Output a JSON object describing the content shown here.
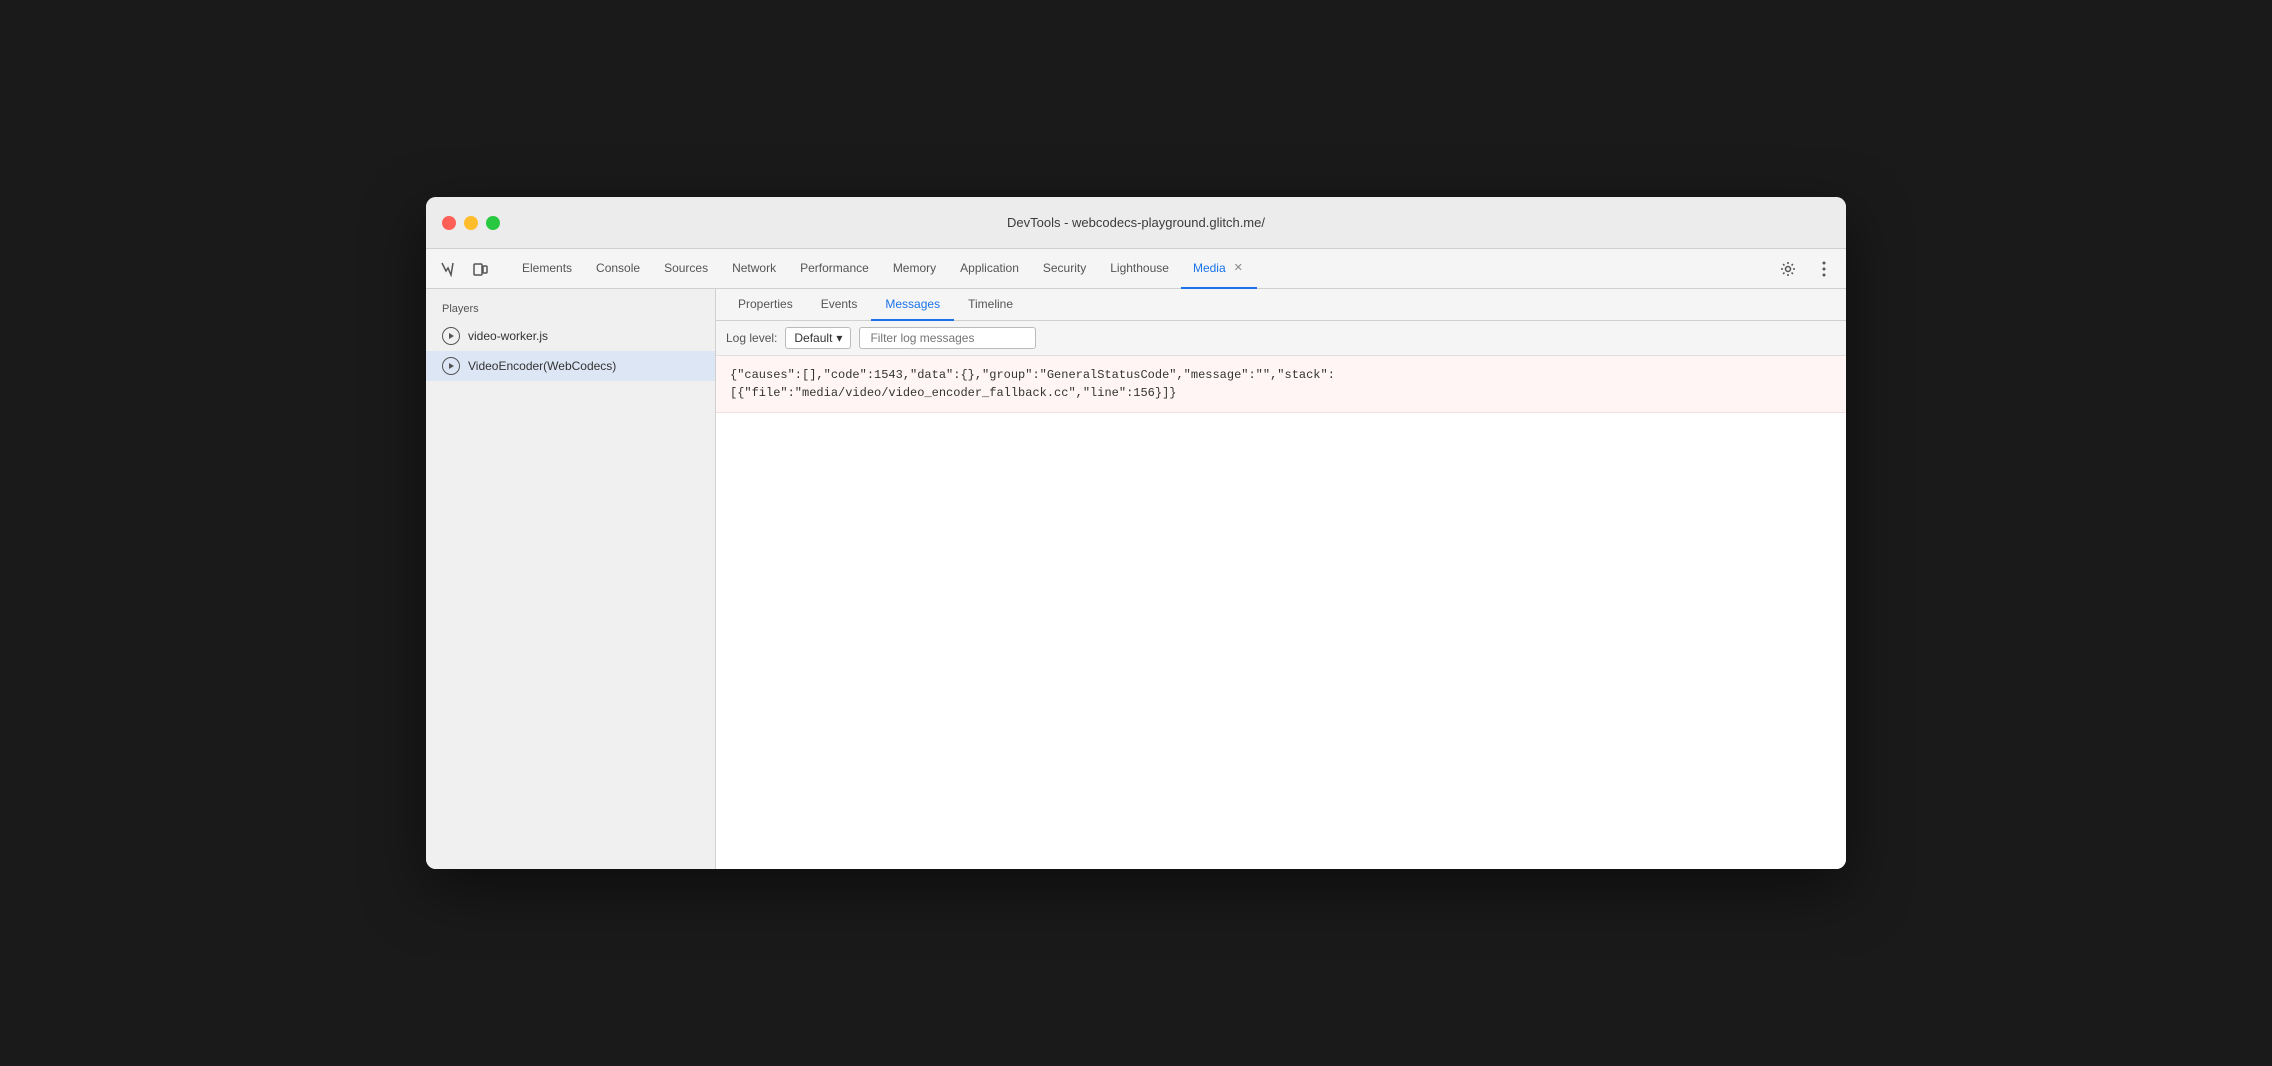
{
  "window": {
    "title": "DevTools - webcodecs-playground.glitch.me/"
  },
  "toolbar": {
    "tabs": [
      {
        "id": "elements",
        "label": "Elements",
        "active": false
      },
      {
        "id": "console",
        "label": "Console",
        "active": false
      },
      {
        "id": "sources",
        "label": "Sources",
        "active": false
      },
      {
        "id": "network",
        "label": "Network",
        "active": false
      },
      {
        "id": "performance",
        "label": "Performance",
        "active": false
      },
      {
        "id": "memory",
        "label": "Memory",
        "active": false
      },
      {
        "id": "application",
        "label": "Application",
        "active": false
      },
      {
        "id": "security",
        "label": "Security",
        "active": false
      },
      {
        "id": "lighthouse",
        "label": "Lighthouse",
        "active": false
      },
      {
        "id": "media",
        "label": "Media",
        "active": true
      }
    ]
  },
  "sidebar": {
    "header": "Players",
    "players": [
      {
        "id": "video-worker",
        "label": "video-worker.js",
        "active": false
      },
      {
        "id": "video-encoder",
        "label": "VideoEncoder(WebCodecs)",
        "active": true
      }
    ]
  },
  "sub_tabs": [
    {
      "id": "properties",
      "label": "Properties",
      "active": false
    },
    {
      "id": "events",
      "label": "Events",
      "active": false
    },
    {
      "id": "messages",
      "label": "Messages",
      "active": true
    },
    {
      "id": "timeline",
      "label": "Timeline",
      "active": false
    }
  ],
  "filter_bar": {
    "log_level_label": "Log level:",
    "log_level_value": "Default",
    "filter_placeholder": "Filter log messages"
  },
  "messages": [
    {
      "type": "error",
      "text": "{\"causes\":[],\"code\":1543,\"data\":{},\"group\":\"GeneralStatusCode\",\"message\":\"\",\"stack\":\n[{\"file\":\"media/video/video_encoder_fallback.cc\",\"line\":156}]}"
    }
  ]
}
